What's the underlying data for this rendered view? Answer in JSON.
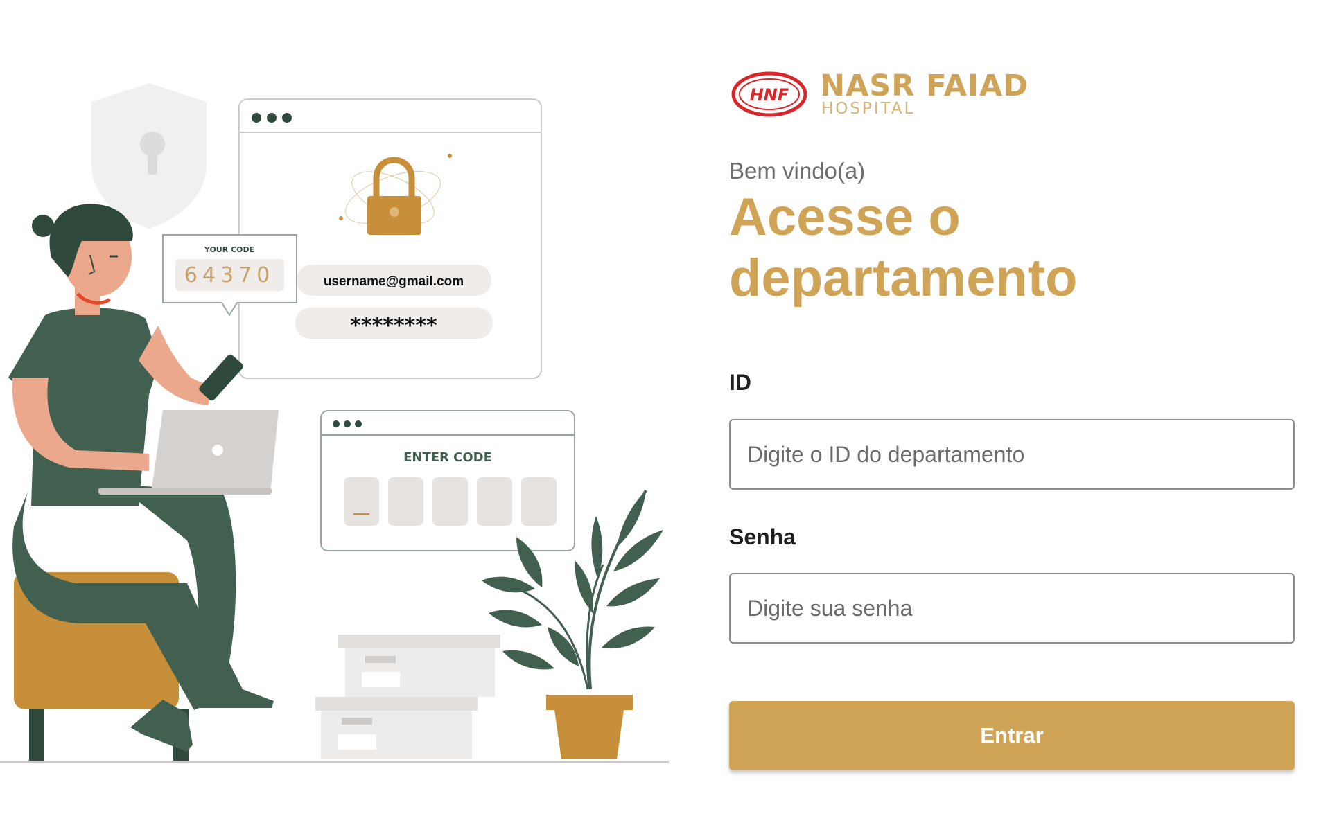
{
  "brand": {
    "badge": "HNF",
    "name": "NASR FAIAD",
    "subtitle": "HOSPITAL",
    "colors": {
      "primary": "#cfa457",
      "badge_red": "#d8262b"
    }
  },
  "welcome": "Bem vindo(a)",
  "title": "Acesse o departamento",
  "form": {
    "id_label": "ID",
    "id_placeholder": "Digite o ID do departamento",
    "password_label": "Senha",
    "password_placeholder": "Digite sua senha",
    "submit_label": "Entrar"
  },
  "illustration": {
    "code_card_title": "YOUR CODE",
    "code_value": "64370",
    "email_value": "username@gmail.com",
    "password_mask": "********",
    "enter_code_title": "ENTER CODE",
    "colors": {
      "green": "#41604f",
      "gold": "#c78f3a",
      "skin": "#eca88c",
      "gray": "#e7e3e1"
    }
  }
}
